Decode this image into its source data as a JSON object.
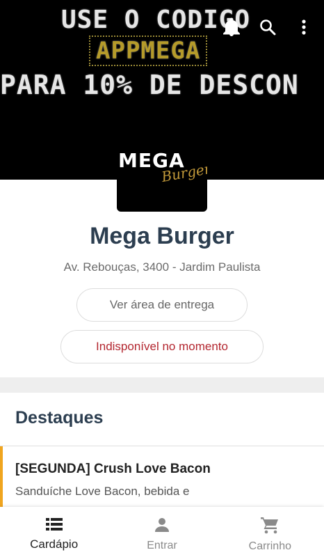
{
  "banner": {
    "line1": "USE O CODIGO",
    "line2": "APPMEGA",
    "line3": "PARA 10% DE DESCON"
  },
  "topbar": {
    "icons": [
      "bell-icon",
      "search-icon",
      "more-vert-icon"
    ]
  },
  "logo": {
    "mega": "MEGA",
    "burger": "Burger"
  },
  "store": {
    "name": "Mega Burger",
    "address": "Av. Rebouças, 3400 - Jardim Paulista",
    "delivery_area_label": "Ver área de entrega",
    "status_label": "Indisponível no momento"
  },
  "highlights": {
    "title": "Destaques",
    "items": [
      {
        "name": "[SEGUNDA] Crush Love Bacon",
        "description": "Sanduíche Love Bacon, bebida e"
      }
    ]
  },
  "bottom_nav": {
    "items": [
      {
        "label": "Cardápio",
        "icon": "menu-list-icon",
        "active": true
      },
      {
        "label": "Entrar",
        "icon": "person-icon",
        "active": false
      },
      {
        "label": "Carrinho",
        "icon": "cart-icon",
        "active": false
      }
    ]
  },
  "colors": {
    "title": "#2c3e50",
    "unavailable": "#b3262f",
    "accent_bar": "#f0a51f",
    "banner_code": "#b59b2a"
  }
}
